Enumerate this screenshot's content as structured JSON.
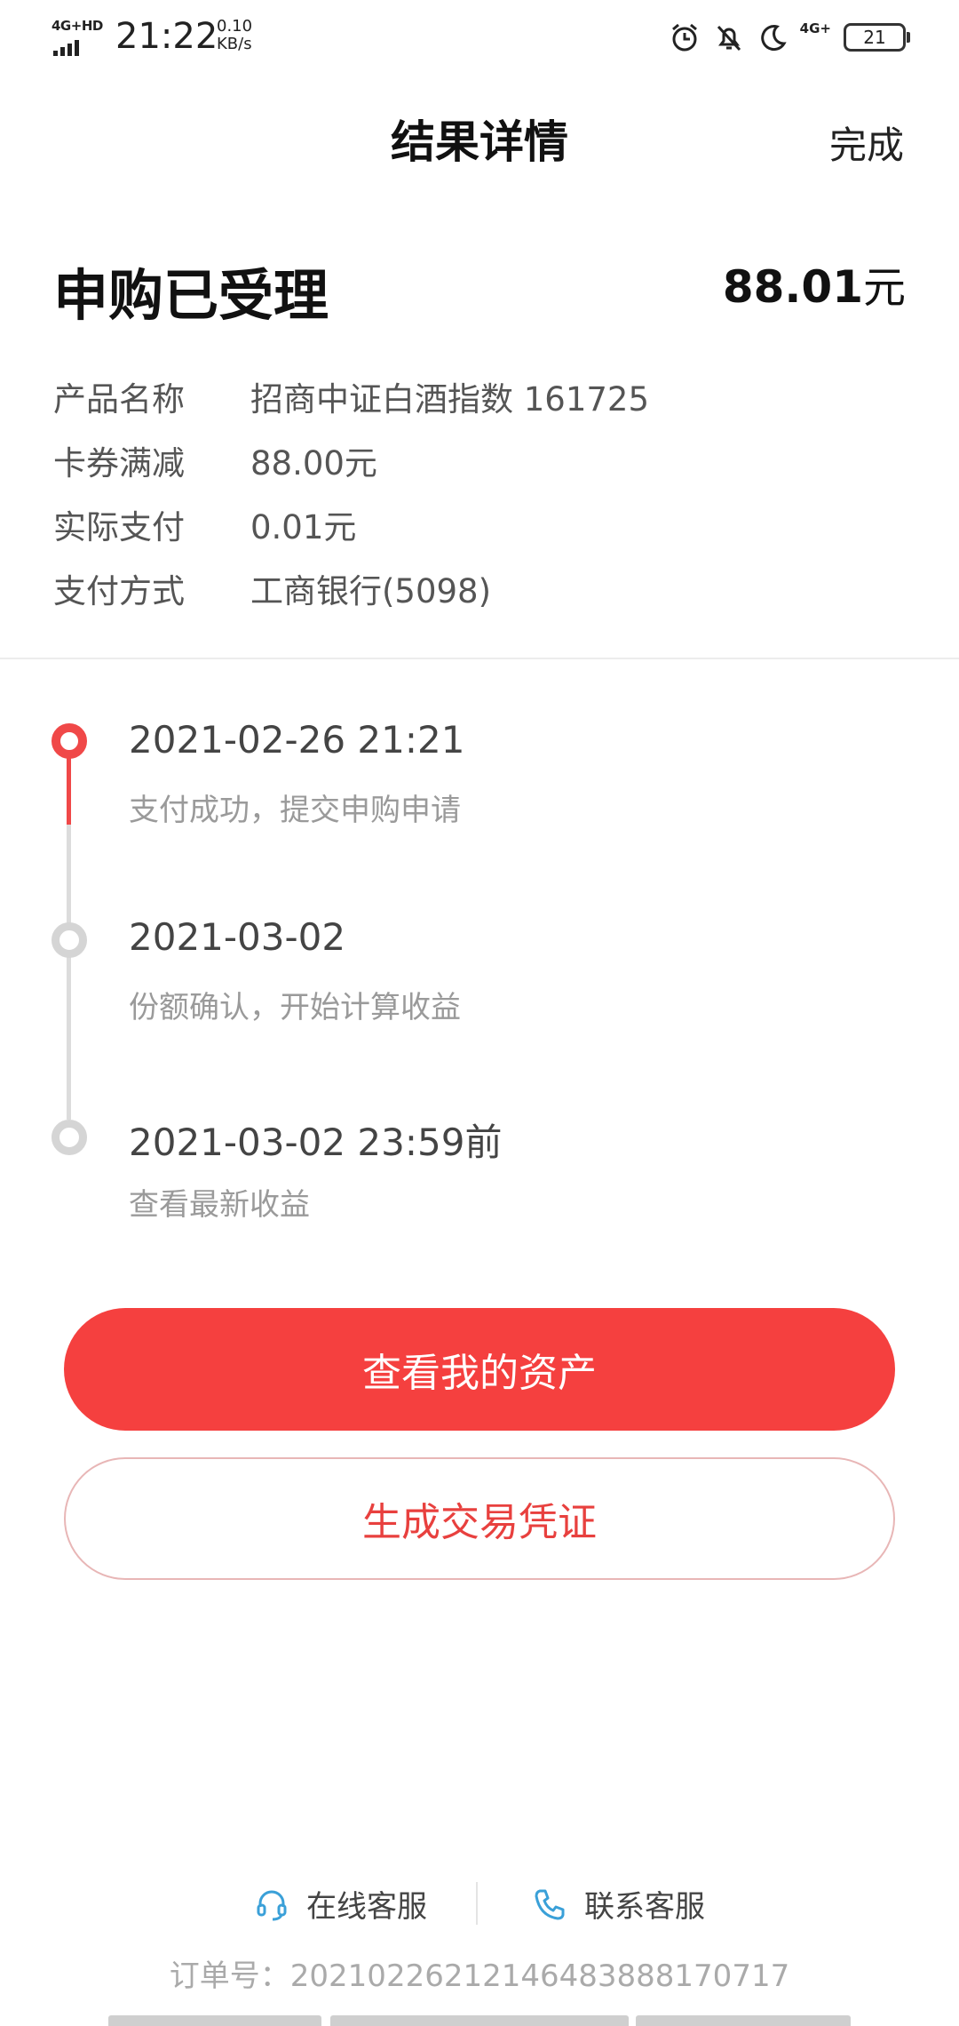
{
  "status_bar": {
    "network": "4G+HD",
    "time": "21:22",
    "speed_value": "0.10",
    "speed_unit": "KB/s",
    "network2": "4G+",
    "battery": "21"
  },
  "header": {
    "title": "结果详情",
    "done_label": "完成"
  },
  "summary": {
    "status_title": "申购已受理",
    "amount": "88.01",
    "amount_unit": "元",
    "details": [
      {
        "key": "产品名称",
        "value": "招商中证白酒指数 161725"
      },
      {
        "key": "卡券满减",
        "value": "88.00元"
      },
      {
        "key": "实际支付",
        "value": "0.01元"
      },
      {
        "key": "支付方式",
        "value": "工商银行(5098)"
      }
    ]
  },
  "timeline": [
    {
      "time": "2021-02-26 21:21",
      "desc": "支付成功，提交申购申请",
      "active": true
    },
    {
      "time": "2021-03-02",
      "desc": "份额确认，开始计算收益",
      "active": false
    },
    {
      "time": "2021-03-02 23:59前",
      "desc": "查看最新收益",
      "active": false
    }
  ],
  "buttons": {
    "primary_label": "查看我的资产",
    "secondary_label": "生成交易凭证"
  },
  "footer": {
    "online_service": "在线客服",
    "contact_service": "联系客服",
    "order_label": "订单号：",
    "order_number": "20210226212146483888170717"
  },
  "colors": {
    "accent": "#f5403f",
    "accent_text": "#e8403e",
    "icon_blue": "#3aa0d8"
  }
}
